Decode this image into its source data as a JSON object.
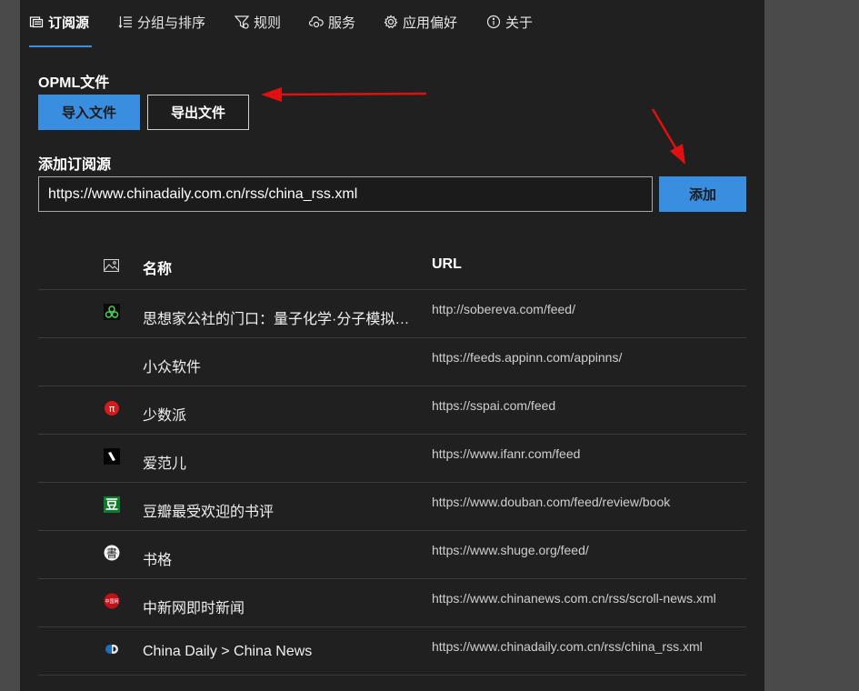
{
  "tabs": [
    {
      "label": "订阅源",
      "icon": "feeds-icon",
      "active": true
    },
    {
      "label": "分组与排序",
      "icon": "list-sort-icon"
    },
    {
      "label": "规则",
      "icon": "filter-icon"
    },
    {
      "label": "服务",
      "icon": "cloud-sync-icon"
    },
    {
      "label": "应用偏好",
      "icon": "gear-icon"
    },
    {
      "label": "关于",
      "icon": "info-icon"
    }
  ],
  "opml": {
    "title": "OPML文件",
    "import_label": "导入文件",
    "export_label": "导出文件"
  },
  "add_feed": {
    "title": "添加订阅源",
    "input_value": "https://www.chinadaily.com.cn/rss/china_rss.xml",
    "add_label": "添加"
  },
  "table": {
    "header_icon": "image-icon",
    "header_name": "名称",
    "header_url": "URL",
    "rows": [
      {
        "name": "思想家公社的门口：量子化学·分子模拟·二次元",
        "url": "http://sobereva.com/feed/",
        "icon": "sobereva-icon"
      },
      {
        "name": "小众软件",
        "url": "https://feeds.appinn.com/appinns/",
        "icon": ""
      },
      {
        "name": "少数派",
        "url": "https://sspai.com/feed",
        "icon": "sspai-icon"
      },
      {
        "name": "爱范儿",
        "url": "https://www.ifanr.com/feed",
        "icon": "ifanr-icon"
      },
      {
        "name": "豆瓣最受欢迎的书评",
        "url": "https://www.douban.com/feed/review/book",
        "icon": "douban-icon",
        "icon_text": "豆"
      },
      {
        "name": "书格",
        "url": "https://www.shuge.org/feed/",
        "icon": "shuge-icon",
        "icon_text": "書"
      },
      {
        "name": "中新网即时新闻",
        "url": "https://www.chinanews.com.cn/rss/scroll-news.xml",
        "icon": "chinanews-icon",
        "icon_text": "中国网"
      },
      {
        "name": "China Daily > China News",
        "url": "https://www.chinadaily.com.cn/rss/china_rss.xml",
        "icon": "chinadaily-icon"
      }
    ]
  },
  "colors": {
    "accent": "#3a8ee0",
    "arrow": "#e01010",
    "panel": "#202020"
  }
}
